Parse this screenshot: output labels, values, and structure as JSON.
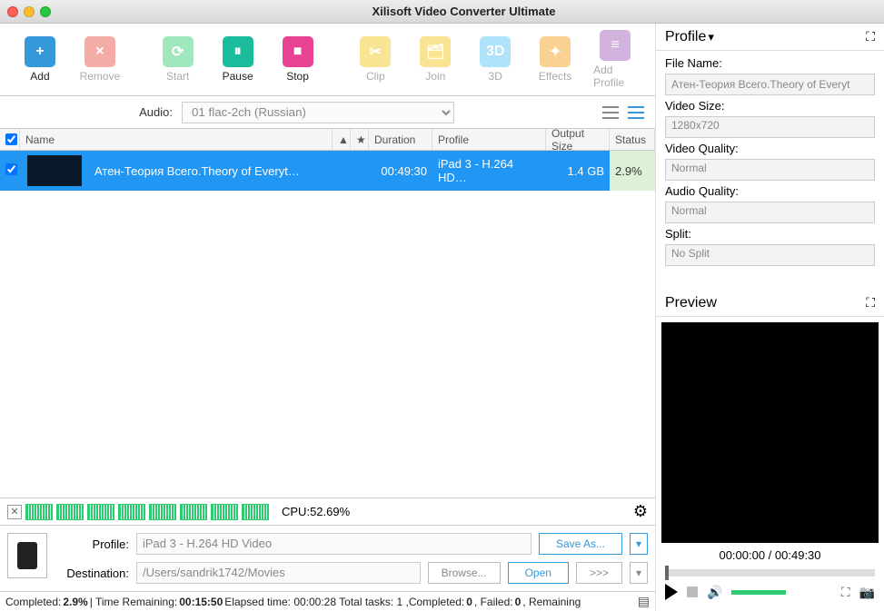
{
  "window_title": "Xilisoft Video Converter Ultimate",
  "toolbar": [
    {
      "name": "add",
      "label": "Add",
      "color": "bg-blue",
      "glyph": "+",
      "disabled": false
    },
    {
      "name": "remove",
      "label": "Remove",
      "color": "bg-red",
      "glyph": "×",
      "disabled": true
    },
    {
      "name": "sep"
    },
    {
      "name": "start",
      "label": "Start",
      "color": "bg-green",
      "glyph": "⟳",
      "disabled": true
    },
    {
      "name": "pause",
      "label": "Pause",
      "color": "bg-blue2",
      "glyph": "⏸",
      "disabled": false
    },
    {
      "name": "stop",
      "label": "Stop",
      "color": "bg-pink",
      "glyph": "■",
      "disabled": false
    },
    {
      "name": "sep"
    },
    {
      "name": "clip",
      "label": "Clip",
      "color": "bg-yellow",
      "glyph": "✂",
      "disabled": true
    },
    {
      "name": "join",
      "label": "Join",
      "color": "bg-yellow",
      "glyph": "🗂",
      "disabled": true
    },
    {
      "name": "3d",
      "label": "3D",
      "color": "bg-teal",
      "glyph": "3D",
      "disabled": true
    },
    {
      "name": "effects",
      "label": "Effects",
      "color": "bg-gold",
      "glyph": "✦",
      "disabled": true
    },
    {
      "name": "addprofile",
      "label": "Add Profile",
      "color": "bg-purple",
      "glyph": "≡",
      "disabled": true
    }
  ],
  "audio": {
    "label": "Audio:",
    "value": "01 flac-2ch (Russian)"
  },
  "columns": {
    "name": "Name",
    "duration": "Duration",
    "profile": "Profile",
    "size": "Output Size",
    "status": "Status"
  },
  "rows": [
    {
      "checked": true,
      "name": "Атен-Теория Всего.Theory of Everyt…",
      "duration": "00:49:30",
      "profile": "iPad 3 - H.264 HD…",
      "size": "1.4 GB",
      "status": "2.9%"
    }
  ],
  "cpu": {
    "label": "CPU:",
    "value": "52.69%"
  },
  "profile_footer": {
    "profile_label": "Profile:",
    "profile_value": "iPad 3 - H.264 HD Video",
    "saveas": "Save As...",
    "dest_label": "Destination:",
    "dest_value": "/Users/sandrik1742/Movies",
    "browse": "Browse...",
    "open": "Open",
    "merge": ">>>"
  },
  "statusbar": {
    "completed_lbl": "Completed: ",
    "completed_val": "2.9%",
    "timerem_lbl": " | Time Remaining: ",
    "timerem_val": "00:15:50",
    "elapsed": " Elapsed time: 00:00:28 Total tasks: 1 ,Completed: ",
    "c0": "0",
    "failed": ", Failed: ",
    "f0": "0",
    "remain": ", Remaining"
  },
  "right": {
    "profile_title": "Profile",
    "filename_lbl": "File Name:",
    "filename_val": "Атен-Теория Всего.Theory of Everyt",
    "videosize_lbl": "Video Size:",
    "videosize_val": "1280x720",
    "videoq_lbl": "Video Quality:",
    "videoq_val": "Normal",
    "audioq_lbl": "Audio Quality:",
    "audioq_val": "Normal",
    "split_lbl": "Split:",
    "split_val": "No Split",
    "preview_title": "Preview",
    "time": "00:00:00 / 00:49:30"
  }
}
